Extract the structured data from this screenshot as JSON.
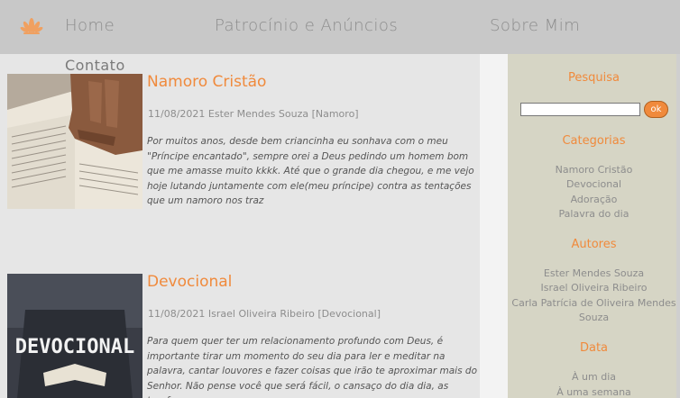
{
  "nav": {
    "home": "Home",
    "sponsors": "Patrocínio e Anúncios",
    "about": "Sobre Mim",
    "contact": "Contato",
    "logo_icon": "lotus-logo-icon"
  },
  "posts": [
    {
      "title": "Namoro Cristão",
      "meta": "11/08/2021 Ester Mendes Souza [Namoro]",
      "excerpt": "Por muitos anos, desde bem criancinha eu sonhava com o meu \"Príncipe encantado\", sempre orei a Deus pedindo um homem bom que me amasse muito kkkk. Até que o grande dia chegou, e me vejo hoje lutando juntamente com ele(meu príncipe) contra as tentações que um namoro nos traz"
    },
    {
      "title": "Devocional",
      "meta": "11/08/2021 Israel Oliveira Ribeiro [Devocional]",
      "excerpt": "Para quem quer ter um relacionamento profundo com Deus, é importante tirar um momento do seu dia para ler e meditar na palavra, cantar louvores e fazer coisas que irão te aproximar mais do Senhor. Não pense você que será fácil, o cansaço do dia dia, as tarefas",
      "thumb_text": "DEVOCIONAL"
    }
  ],
  "sidebar": {
    "search_title": "Pesquisa",
    "search_value": "",
    "search_button": "ok",
    "categories_title": "Categorias",
    "categories": [
      "Namoro Cristão",
      "Devocional",
      "Adoração",
      "Palavra do dia"
    ],
    "authors_title": "Autores",
    "authors": [
      "Ester Mendes Souza",
      "Israel Oliveira Ribeiro",
      "Carla Patrícia de Oliveira Mendes",
      "Souza"
    ],
    "date_title": "Data",
    "dates": [
      "À um dia",
      "À uma semana"
    ]
  },
  "colors": {
    "accent": "#f08a3c",
    "nav_bg": "#c8c8c8",
    "sidebar_bg": "#d6d5c5",
    "main_bg": "#e6e6e6"
  }
}
